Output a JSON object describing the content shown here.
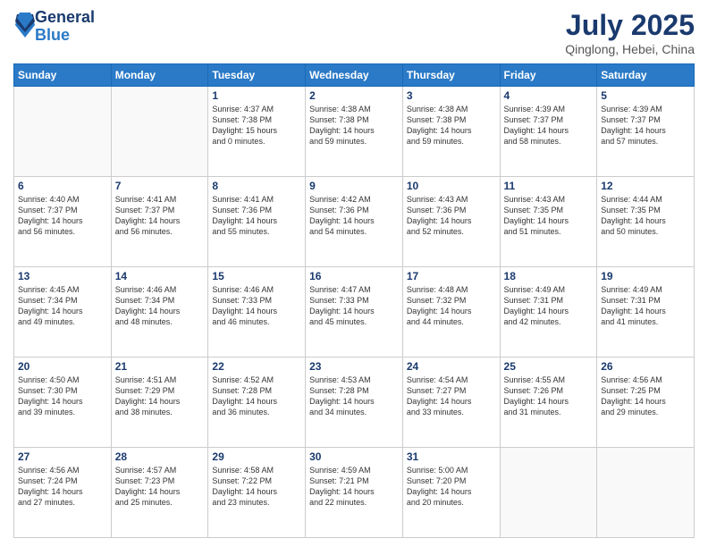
{
  "header": {
    "logo_general": "General",
    "logo_blue": "Blue",
    "month_title": "July 2025",
    "location": "Qinglong, Hebei, China"
  },
  "weekdays": [
    "Sunday",
    "Monday",
    "Tuesday",
    "Wednesday",
    "Thursday",
    "Friday",
    "Saturday"
  ],
  "weeks": [
    [
      {
        "day": "",
        "text": ""
      },
      {
        "day": "",
        "text": ""
      },
      {
        "day": "1",
        "text": "Sunrise: 4:37 AM\nSunset: 7:38 PM\nDaylight: 15 hours\nand 0 minutes."
      },
      {
        "day": "2",
        "text": "Sunrise: 4:38 AM\nSunset: 7:38 PM\nDaylight: 14 hours\nand 59 minutes."
      },
      {
        "day": "3",
        "text": "Sunrise: 4:38 AM\nSunset: 7:38 PM\nDaylight: 14 hours\nand 59 minutes."
      },
      {
        "day": "4",
        "text": "Sunrise: 4:39 AM\nSunset: 7:37 PM\nDaylight: 14 hours\nand 58 minutes."
      },
      {
        "day": "5",
        "text": "Sunrise: 4:39 AM\nSunset: 7:37 PM\nDaylight: 14 hours\nand 57 minutes."
      }
    ],
    [
      {
        "day": "6",
        "text": "Sunrise: 4:40 AM\nSunset: 7:37 PM\nDaylight: 14 hours\nand 56 minutes."
      },
      {
        "day": "7",
        "text": "Sunrise: 4:41 AM\nSunset: 7:37 PM\nDaylight: 14 hours\nand 56 minutes."
      },
      {
        "day": "8",
        "text": "Sunrise: 4:41 AM\nSunset: 7:36 PM\nDaylight: 14 hours\nand 55 minutes."
      },
      {
        "day": "9",
        "text": "Sunrise: 4:42 AM\nSunset: 7:36 PM\nDaylight: 14 hours\nand 54 minutes."
      },
      {
        "day": "10",
        "text": "Sunrise: 4:43 AM\nSunset: 7:36 PM\nDaylight: 14 hours\nand 52 minutes."
      },
      {
        "day": "11",
        "text": "Sunrise: 4:43 AM\nSunset: 7:35 PM\nDaylight: 14 hours\nand 51 minutes."
      },
      {
        "day": "12",
        "text": "Sunrise: 4:44 AM\nSunset: 7:35 PM\nDaylight: 14 hours\nand 50 minutes."
      }
    ],
    [
      {
        "day": "13",
        "text": "Sunrise: 4:45 AM\nSunset: 7:34 PM\nDaylight: 14 hours\nand 49 minutes."
      },
      {
        "day": "14",
        "text": "Sunrise: 4:46 AM\nSunset: 7:34 PM\nDaylight: 14 hours\nand 48 minutes."
      },
      {
        "day": "15",
        "text": "Sunrise: 4:46 AM\nSunset: 7:33 PM\nDaylight: 14 hours\nand 46 minutes."
      },
      {
        "day": "16",
        "text": "Sunrise: 4:47 AM\nSunset: 7:33 PM\nDaylight: 14 hours\nand 45 minutes."
      },
      {
        "day": "17",
        "text": "Sunrise: 4:48 AM\nSunset: 7:32 PM\nDaylight: 14 hours\nand 44 minutes."
      },
      {
        "day": "18",
        "text": "Sunrise: 4:49 AM\nSunset: 7:31 PM\nDaylight: 14 hours\nand 42 minutes."
      },
      {
        "day": "19",
        "text": "Sunrise: 4:49 AM\nSunset: 7:31 PM\nDaylight: 14 hours\nand 41 minutes."
      }
    ],
    [
      {
        "day": "20",
        "text": "Sunrise: 4:50 AM\nSunset: 7:30 PM\nDaylight: 14 hours\nand 39 minutes."
      },
      {
        "day": "21",
        "text": "Sunrise: 4:51 AM\nSunset: 7:29 PM\nDaylight: 14 hours\nand 38 minutes."
      },
      {
        "day": "22",
        "text": "Sunrise: 4:52 AM\nSunset: 7:28 PM\nDaylight: 14 hours\nand 36 minutes."
      },
      {
        "day": "23",
        "text": "Sunrise: 4:53 AM\nSunset: 7:28 PM\nDaylight: 14 hours\nand 34 minutes."
      },
      {
        "day": "24",
        "text": "Sunrise: 4:54 AM\nSunset: 7:27 PM\nDaylight: 14 hours\nand 33 minutes."
      },
      {
        "day": "25",
        "text": "Sunrise: 4:55 AM\nSunset: 7:26 PM\nDaylight: 14 hours\nand 31 minutes."
      },
      {
        "day": "26",
        "text": "Sunrise: 4:56 AM\nSunset: 7:25 PM\nDaylight: 14 hours\nand 29 minutes."
      }
    ],
    [
      {
        "day": "27",
        "text": "Sunrise: 4:56 AM\nSunset: 7:24 PM\nDaylight: 14 hours\nand 27 minutes."
      },
      {
        "day": "28",
        "text": "Sunrise: 4:57 AM\nSunset: 7:23 PM\nDaylight: 14 hours\nand 25 minutes."
      },
      {
        "day": "29",
        "text": "Sunrise: 4:58 AM\nSunset: 7:22 PM\nDaylight: 14 hours\nand 23 minutes."
      },
      {
        "day": "30",
        "text": "Sunrise: 4:59 AM\nSunset: 7:21 PM\nDaylight: 14 hours\nand 22 minutes."
      },
      {
        "day": "31",
        "text": "Sunrise: 5:00 AM\nSunset: 7:20 PM\nDaylight: 14 hours\nand 20 minutes."
      },
      {
        "day": "",
        "text": ""
      },
      {
        "day": "",
        "text": ""
      }
    ]
  ]
}
